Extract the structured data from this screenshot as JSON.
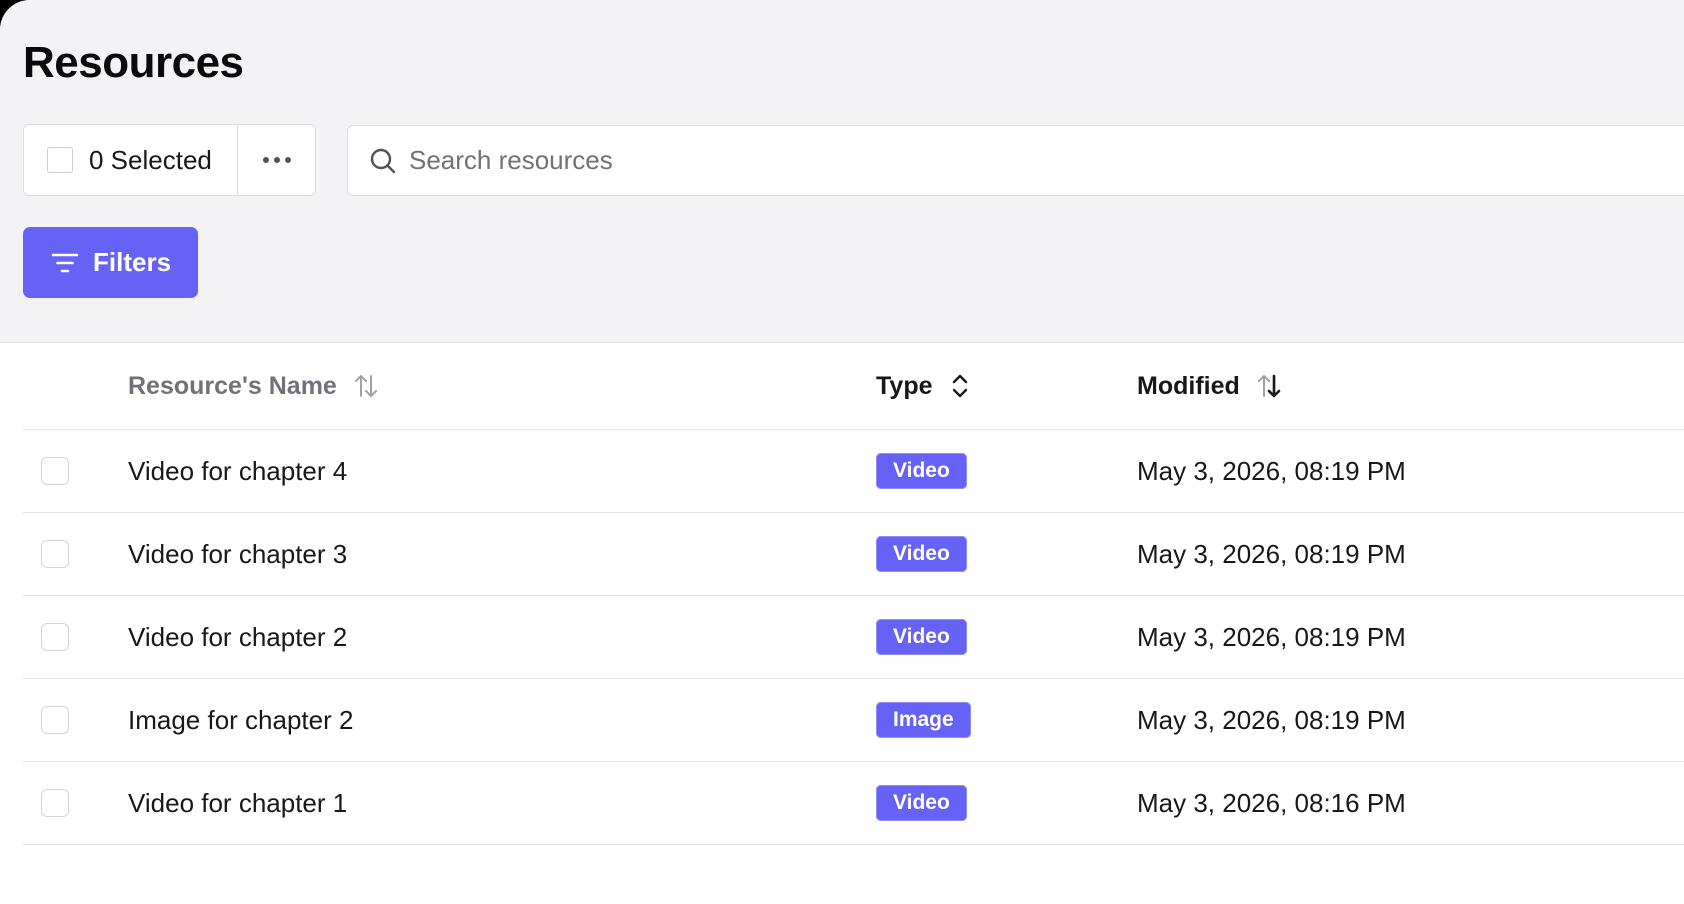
{
  "page": {
    "title": "Resources"
  },
  "toolbar": {
    "selected_label": "0 Selected",
    "search_placeholder": "Search resources",
    "filters_label": "Filters"
  },
  "colors": {
    "accent": "#6562f5",
    "header_background": "#f3f3f5",
    "text_primary": "#18181b",
    "text_muted": "#71717a"
  },
  "icons": {
    "more": "more-horizontal-icon",
    "search": "search-icon",
    "filter": "filter-lines-icon",
    "sort": "sort-arrows-icon",
    "sort_type": "chevron-up-down-icon"
  },
  "table": {
    "columns": [
      {
        "label": "Resource's Name",
        "sort": "unsorted"
      },
      {
        "label": "Type",
        "sort": "unsorted"
      },
      {
        "label": "Modified",
        "sort": "descending"
      }
    ],
    "rows": [
      {
        "name": "Video for chapter 4",
        "type": "Video",
        "modified": "May 3, 2026, 08:19 PM"
      },
      {
        "name": "Video for chapter 3",
        "type": "Video",
        "modified": "May 3, 2026, 08:19 PM"
      },
      {
        "name": "Video for chapter 2",
        "type": "Video",
        "modified": "May 3, 2026, 08:19 PM"
      },
      {
        "name": "Image for chapter 2",
        "type": "Image",
        "modified": "May 3, 2026, 08:19 PM"
      },
      {
        "name": "Video for chapter 1",
        "type": "Video",
        "modified": "May 3, 2026, 08:16 PM"
      }
    ]
  }
}
